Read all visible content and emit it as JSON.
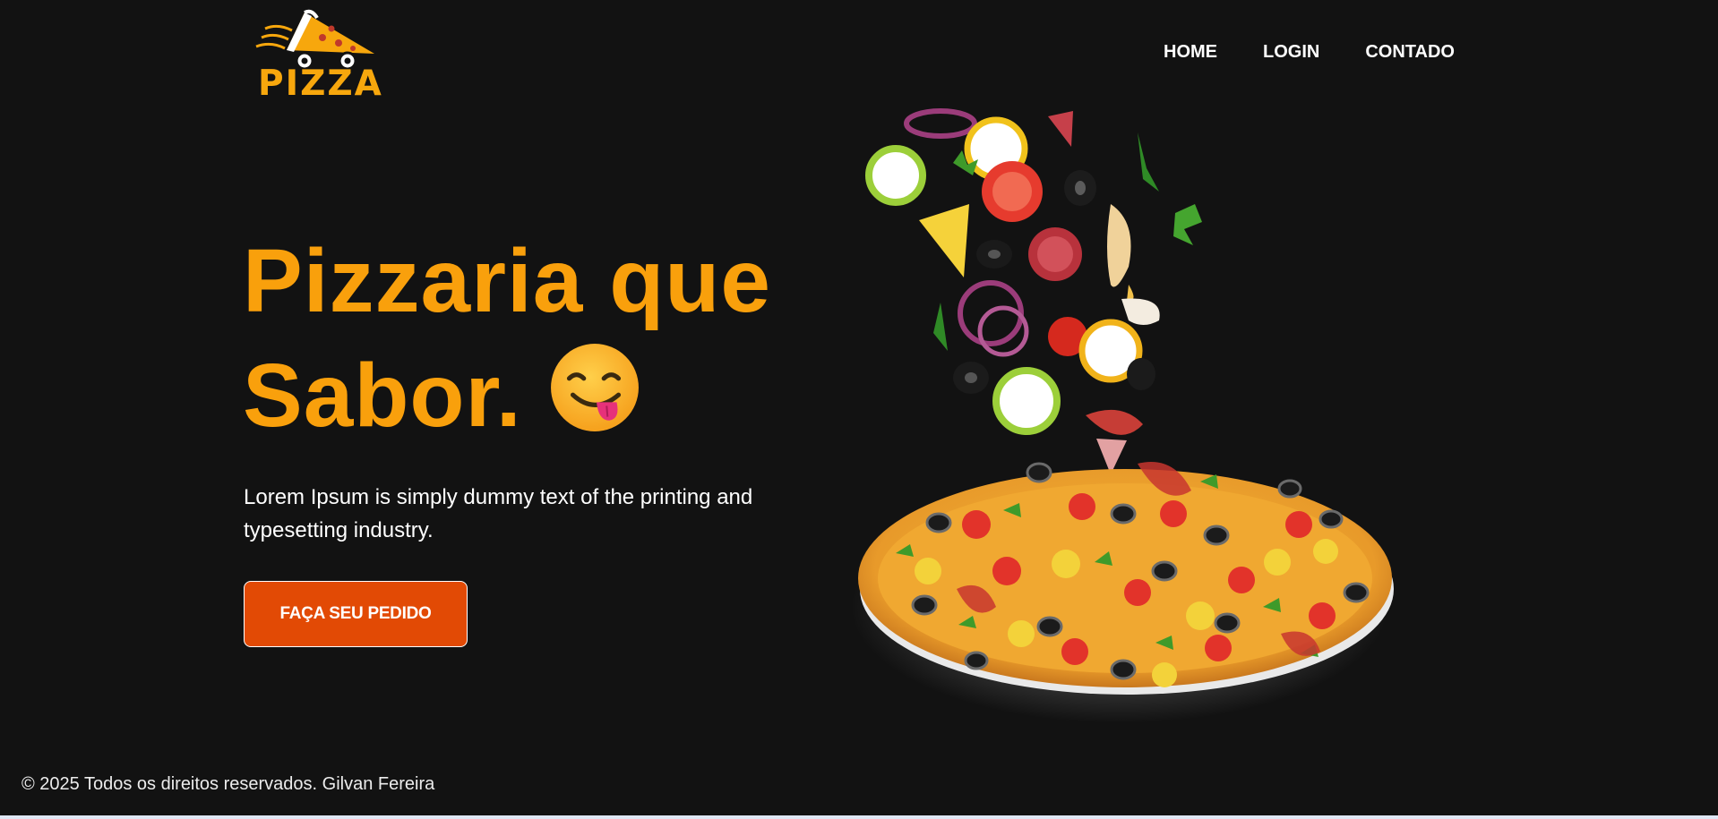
{
  "header": {
    "logo_text": "PIZZA",
    "nav": [
      "HOME",
      "LOGIN",
      "CONTADO"
    ]
  },
  "hero": {
    "title_line1": "Pizzaria que",
    "title_line2": "Sabor.",
    "title_emoji": "face-savoring-food-emoji",
    "description": "Lorem Ipsum is simply dummy text of the printing and typesetting industry.",
    "cta_label": "FAÇA SEU PEDIDO"
  },
  "footer": {
    "copyright": "© 2025 Todos os direitos reservados. Gilvan Fereira"
  },
  "colors": {
    "background": "#121212",
    "accent": "#f9a00c",
    "button": "#e24a05",
    "text": "#ffffff"
  }
}
